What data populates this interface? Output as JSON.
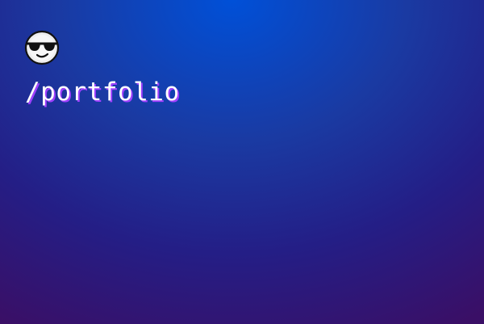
{
  "header": {
    "avatar_icon": "cool-face-sunglasses-icon",
    "title": "/portfolio"
  },
  "colors": {
    "background_top": "#0050d8",
    "background_bottom": "#3a0f66",
    "title_text": "#ffffff",
    "title_shadow": "#a040ff"
  }
}
